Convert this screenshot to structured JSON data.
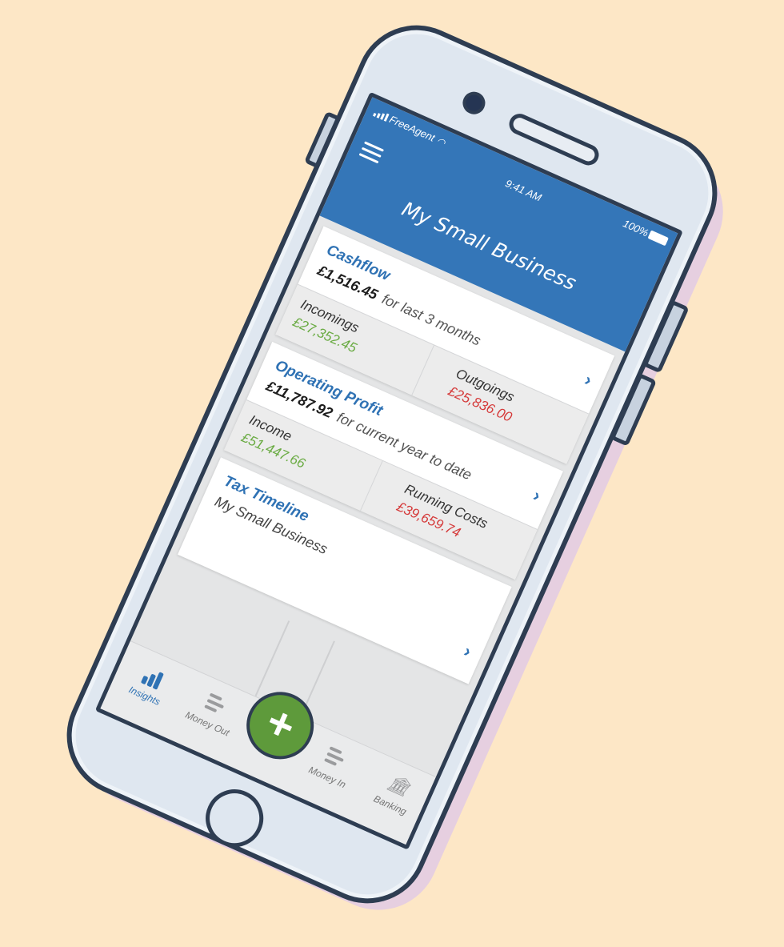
{
  "status_bar": {
    "carrier": "FreeAgent",
    "time": "9:41 AM",
    "battery": "100%"
  },
  "header": {
    "title": "My Small Business"
  },
  "cashflow": {
    "title": "Cashflow",
    "amount": "£1,516.45",
    "period": "for last 3 months",
    "incomings_label": "Incomings",
    "incomings_value": "£27,352.45",
    "outgoings_label": "Outgoings",
    "outgoings_value": "£25,836.00"
  },
  "operating_profit": {
    "title": "Operating Profit",
    "amount": "£11,787.92",
    "period": "for current year to date",
    "income_label": "Income",
    "income_value": "£51,447.66",
    "running_costs_label": "Running Costs",
    "running_costs_value": "£39,659.74"
  },
  "tax_timeline": {
    "title": "Tax Timeline",
    "subtitle": "My Small Business"
  },
  "tabbar": {
    "insights": "Insights",
    "money_out": "Money Out",
    "add": "+",
    "money_in": "Money In",
    "banking": "Banking"
  },
  "colors": {
    "background": "#fde7c6",
    "header_blue": "#3476b8",
    "positive_green": "#6aab43",
    "negative_red": "#d53a3a",
    "add_button_green": "#5e9a3b"
  },
  "icons": [
    "menu-icon",
    "signal-icon",
    "wifi-icon",
    "battery-icon",
    "chevron-right-icon",
    "bar-chart-icon",
    "list-arrow-icon",
    "bank-icon",
    "plus-icon"
  ]
}
